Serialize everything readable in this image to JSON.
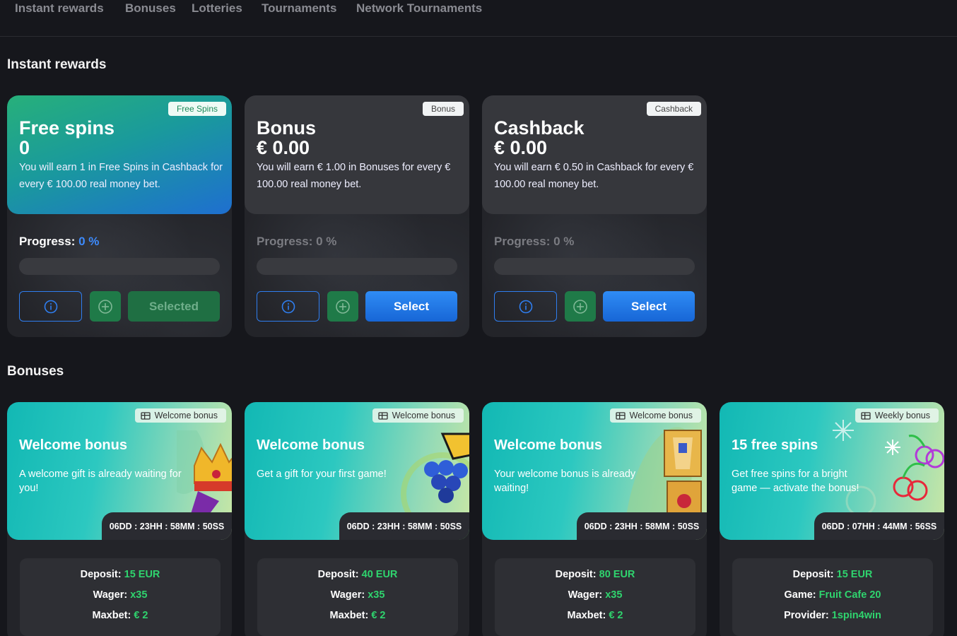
{
  "nav": {
    "tabs": [
      "Instant rewards",
      "Bonuses",
      "Lotteries",
      "Tournaments",
      "Network Tournaments"
    ]
  },
  "sections": {
    "instant": "Instant rewards",
    "bonuses": "Bonuses"
  },
  "progress_label": "Progress:",
  "rewards": [
    {
      "badge": "Free Spins",
      "title": "Free spins",
      "amount": "0",
      "desc": "You will earn 1 in Free Spins in Cashback for every € 100.00 real money bet.",
      "progress": "0 %",
      "progress_fraction": 0,
      "action": "Selected"
    },
    {
      "badge": "Bonus",
      "title": "Bonus",
      "amount": "€ 0.00",
      "desc": "You will earn € 1.00 in Bonuses for every € 100.00 real money bet.",
      "progress": "0 %",
      "progress_fraction": 0,
      "action": "Select"
    },
    {
      "badge": "Cashback",
      "title": "Cashback",
      "amount": "€ 0.00",
      "desc": "You will earn € 0.50 in Cashback for every € 100.00 real money bet.",
      "progress": "0 %",
      "progress_fraction": 0,
      "action": "Select"
    }
  ],
  "bonuses": [
    {
      "badge": "Welcome bonus",
      "title": "Welcome bonus",
      "desc": "A welcome gift is already waiting for you!",
      "timer": "06DD : 23HH : 58MM : 50SS",
      "terms": [
        {
          "label": "Deposit:",
          "value": "15 EUR"
        },
        {
          "label": "Wager:",
          "value": "x35"
        },
        {
          "label": "Maxbet:",
          "value": "€ 2"
        }
      ]
    },
    {
      "badge": "Welcome bonus",
      "title": "Welcome bonus",
      "desc": "Get a gift for your first game!",
      "timer": "06DD : 23HH : 58MM : 50SS",
      "terms": [
        {
          "label": "Deposit:",
          "value": "40 EUR"
        },
        {
          "label": "Wager:",
          "value": "x35"
        },
        {
          "label": "Maxbet:",
          "value": "€ 2"
        }
      ]
    },
    {
      "badge": "Welcome bonus",
      "title": "Welcome bonus",
      "desc": "Your welcome bonus is already waiting!",
      "timer": "06DD : 23HH : 58MM : 50SS",
      "terms": [
        {
          "label": "Deposit:",
          "value": "80 EUR"
        },
        {
          "label": "Wager:",
          "value": "x35"
        },
        {
          "label": "Maxbet:",
          "value": "€ 2"
        }
      ]
    },
    {
      "badge": "Weekly bonus",
      "title": "15 free spins",
      "desc": "Get free spins for a bright game — activate the bonus!",
      "timer": "06DD : 07HH : 44MM : 56SS",
      "terms": [
        {
          "label": "Deposit:",
          "value": "15 EUR"
        },
        {
          "label": "Game:",
          "value": "Fruit Cafe 20"
        },
        {
          "label": "Provider:",
          "value": "1spin4win"
        }
      ]
    }
  ],
  "colors": {
    "accent_blue": "#2f7ef0",
    "accent_green": "#2fd46e",
    "background": "#16171c"
  }
}
